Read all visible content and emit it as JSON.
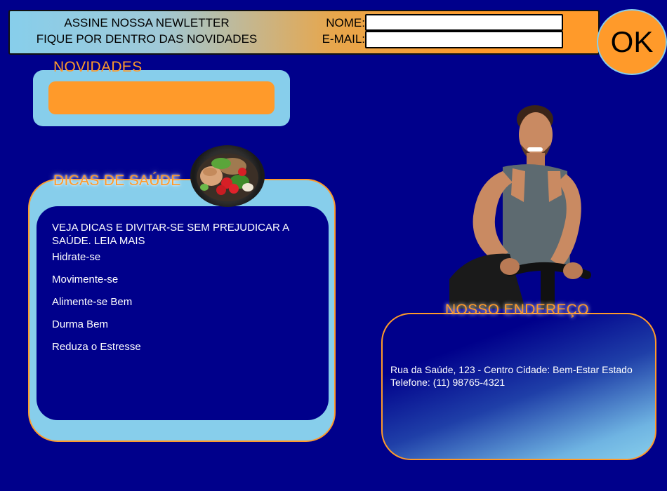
{
  "newsletter": {
    "line1": "ASSINE NOSSA NEWLETTER",
    "line2": "FIQUE POR DENTRO DAS NOVIDADES",
    "name_label": "NOME:",
    "email_label": "E-MAIL:",
    "name_value": "",
    "email_value": "",
    "ok_label": "OK"
  },
  "novidades": {
    "title": "NOVIDADES"
  },
  "dicas": {
    "title": "DICAS DE SAÚDE",
    "intro": "VEJA DICAS E DIVITAR-SE SEM PREJUDICAR A SAÚDE. LEIA MAIS",
    "items": [
      "Hidrate-se",
      "Movimente-se",
      "Alimente-se Bem",
      "Durma Bem",
      "Reduza o Estresse"
    ]
  },
  "endereco": {
    "title": "NOSSO ENDEREÇO",
    "address": "Rua da Saúde, 123 - Centro Cidade: Bem-Estar Estado",
    "phone": "Telefone: (11) 98765-4321"
  },
  "colors": {
    "background": "#00008b",
    "accent_orange": "#ff9a2a",
    "light_blue": "#87ceeb"
  },
  "images": {
    "salad": "salad-bowl-image",
    "athlete": "man-on-exercise-bike-image"
  }
}
